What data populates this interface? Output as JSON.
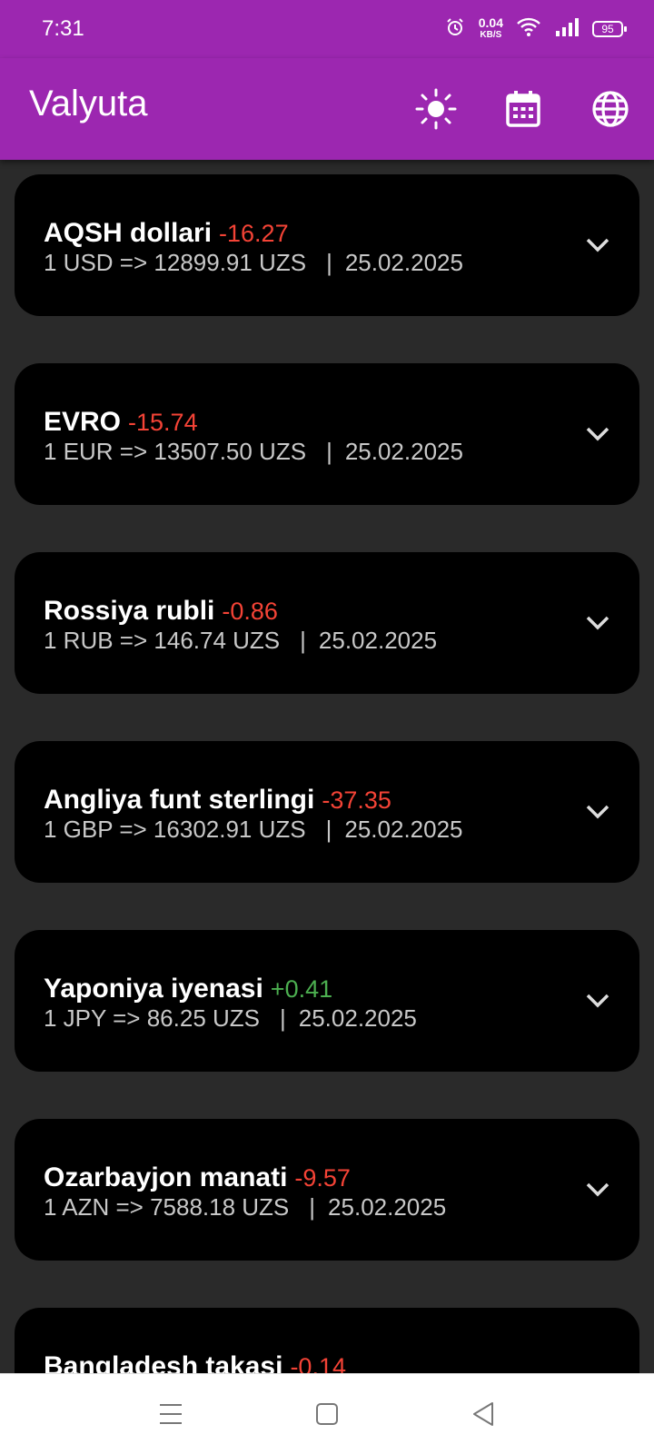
{
  "status_bar": {
    "time": "7:31",
    "net_speed_value": "0.04",
    "net_speed_unit": "KB/S",
    "battery": "95"
  },
  "app_bar": {
    "title": "Valyuta",
    "icons": [
      "sun-icon",
      "calendar-icon",
      "globe-icon"
    ]
  },
  "currencies": [
    {
      "name": "AQSH dollari",
      "diff": "-16.27",
      "trend": "down",
      "rate": "1 USD => 12899.91 UZS",
      "date": "25.02.2025"
    },
    {
      "name": "EVRO",
      "diff": "-15.74",
      "trend": "down",
      "rate": "1 EUR => 13507.50 UZS",
      "date": "25.02.2025"
    },
    {
      "name": "Rossiya rubli",
      "diff": "-0.86",
      "trend": "down",
      "rate": "1 RUB => 146.74 UZS",
      "date": "25.02.2025"
    },
    {
      "name": "Angliya funt sterlingi",
      "diff": "-37.35",
      "trend": "down",
      "rate": "1 GBP => 16302.91 UZS",
      "date": "25.02.2025"
    },
    {
      "name": "Yaponiya iyenasi",
      "diff": "+0.41",
      "trend": "up",
      "rate": "1 JPY => 86.25 UZS",
      "date": "25.02.2025"
    },
    {
      "name": "Ozarbayjon manati",
      "diff": "-9.57",
      "trend": "down",
      "rate": "1 AZN => 7588.18 UZS",
      "date": "25.02.2025"
    },
    {
      "name": "Bangladesh takasi",
      "diff": "-0.14",
      "trend": "down"
    }
  ],
  "separator": "|",
  "colors": {
    "primary": "#9c27b0",
    "negative": "#f44336",
    "positive": "#4caf50",
    "card": "#000000",
    "background": "#2a2a2a"
  },
  "nav_bar": {
    "icons": [
      "menu-icon",
      "home-square-icon",
      "back-triangle-icon"
    ]
  }
}
